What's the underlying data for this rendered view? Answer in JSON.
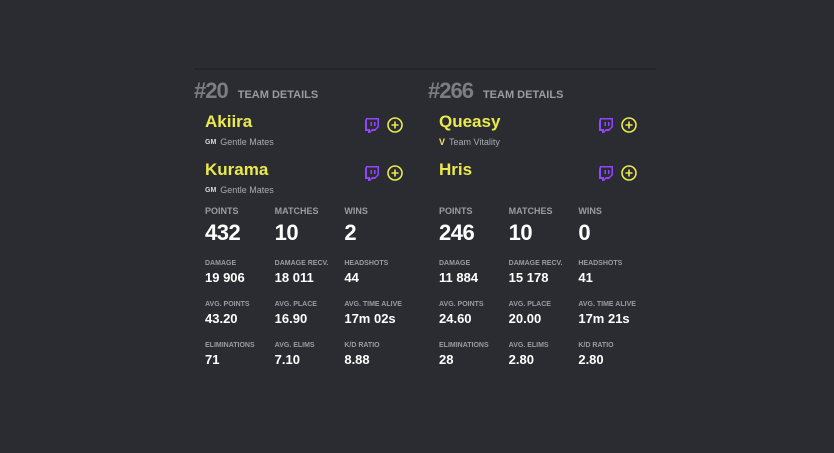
{
  "teams": [
    {
      "rank": "#20",
      "header_label": "TEAM DETAILS",
      "players": [
        {
          "name": "Akiira",
          "org": "Gentle Mates",
          "org_logo": "gentle-mates-logo"
        },
        {
          "name": "Kurama",
          "org": "Gentle Mates",
          "org_logo": "gentle-mates-logo"
        }
      ],
      "stats": {
        "points": {
          "label": "POINTS",
          "value": "432"
        },
        "matches": {
          "label": "MATCHES",
          "value": "10"
        },
        "wins": {
          "label": "WINS",
          "value": "2"
        },
        "damage": {
          "label": "DAMAGE",
          "value": "19 906"
        },
        "damage_recv": {
          "label": "DAMAGE RECV.",
          "value": "18 011"
        },
        "headshots": {
          "label": "HEADSHOTS",
          "value": "44"
        },
        "avg_points": {
          "label": "AVG. POINTS",
          "value": "43.20"
        },
        "avg_place": {
          "label": "AVG. PLACE",
          "value": "16.90"
        },
        "avg_time_alive": {
          "label": "AVG. TIME ALIVE",
          "value": "17m 02s"
        },
        "eliminations": {
          "label": "ELIMINATIONS",
          "value": "71"
        },
        "avg_elims": {
          "label": "AVG. ELIMS",
          "value": "7.10"
        },
        "kd_ratio": {
          "label": "K/D RATIO",
          "value": "8.88"
        }
      }
    },
    {
      "rank": "#266",
      "header_label": "TEAM DETAILS",
      "players": [
        {
          "name": "Queasy",
          "org": "Team Vitality",
          "org_logo": "team-vitality-logo"
        },
        {
          "name": "Hris",
          "org": "",
          "org_logo": ""
        }
      ],
      "stats": {
        "points": {
          "label": "POINTS",
          "value": "246"
        },
        "matches": {
          "label": "MATCHES",
          "value": "10"
        },
        "wins": {
          "label": "WINS",
          "value": "0"
        },
        "damage": {
          "label": "DAMAGE",
          "value": "11 884"
        },
        "damage_recv": {
          "label": "DAMAGE RECV.",
          "value": "15 178"
        },
        "headshots": {
          "label": "HEADSHOTS",
          "value": "41"
        },
        "avg_points": {
          "label": "AVG. POINTS",
          "value": "24.60"
        },
        "avg_place": {
          "label": "AVG. PLACE",
          "value": "20.00"
        },
        "avg_time_alive": {
          "label": "AVG. TIME ALIVE",
          "value": "17m 21s"
        },
        "eliminations": {
          "label": "ELIMINATIONS",
          "value": "28"
        },
        "avg_elims": {
          "label": "AVG. ELIMS",
          "value": "2.80"
        },
        "kd_ratio": {
          "label": "K/D RATIO",
          "value": "2.80"
        }
      }
    }
  ],
  "colors": {
    "background": "#2a2c31",
    "player_name": "#eaea4f",
    "twitch": "#9146ff",
    "add": "#eaea4f",
    "label": "#9a9ca1"
  },
  "icons": {
    "twitch": "twitch-icon",
    "add": "add-circle-icon"
  }
}
